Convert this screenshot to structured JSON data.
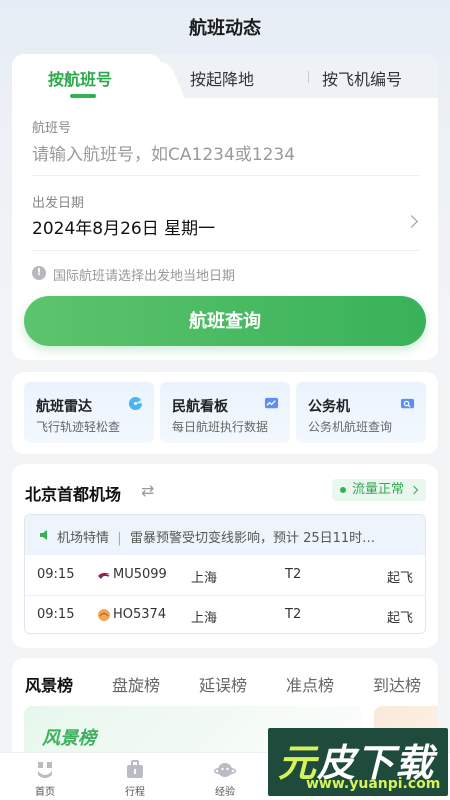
{
  "header": {
    "title": "航班动态"
  },
  "search": {
    "tabs": [
      {
        "label": "按航班号",
        "active": true
      },
      {
        "label": "按起降地",
        "active": false
      },
      {
        "label": "按飞机编号",
        "active": false
      }
    ],
    "flight_no_label": "航班号",
    "flight_no_placeholder": "请输入航班号，如CA1234或1234",
    "date_label": "出发日期",
    "date_value": "2024年8月26日  星期一",
    "hint": "国际航班请选择出发地当地日期",
    "query_button": "航班查询"
  },
  "services": [
    {
      "title": "航班雷达",
      "subtitle": "飞行轨迹轻松查",
      "icon": "radar-icon"
    },
    {
      "title": "民航看板",
      "subtitle": "每日航班执行数据",
      "icon": "chart-board-icon"
    },
    {
      "title": "公务机",
      "subtitle": "公务机航班查询",
      "icon": "search-card-icon"
    }
  ],
  "airport": {
    "name": "北京首都机场",
    "flow_status": "流量正常",
    "notice_label": "机场特情",
    "notice_text": "雷暴预警受切变线影响，预计 25日11时…",
    "flights": [
      {
        "time": "09:15",
        "airline_logo": "china-eastern-logo",
        "flight_no": "MU5099",
        "city": "上海",
        "terminal": "T2",
        "status": "起飞"
      },
      {
        "time": "09:15",
        "airline_logo": "shanghai-airlines-logo",
        "flight_no": "HO5374",
        "city": "上海",
        "terminal": "T2",
        "status": "起飞"
      }
    ]
  },
  "rankings": {
    "tabs": [
      "风景榜",
      "盘旋榜",
      "延误榜",
      "准点榜",
      "到达榜"
    ],
    "active_tab": "风景榜",
    "banner_title": "风景榜"
  },
  "bottom_nav": [
    {
      "label": "首页",
      "icon": "home-icon"
    },
    {
      "label": "行程",
      "icon": "luggage-icon"
    },
    {
      "label": "经验",
      "icon": "planet-icon"
    }
  ],
  "watermark": {
    "text_a": "元",
    "text_b": "皮下载",
    "url": "www.yuanpi.com"
  },
  "colors": {
    "accent": "#34b152",
    "text": "#222222",
    "muted": "#999999"
  }
}
